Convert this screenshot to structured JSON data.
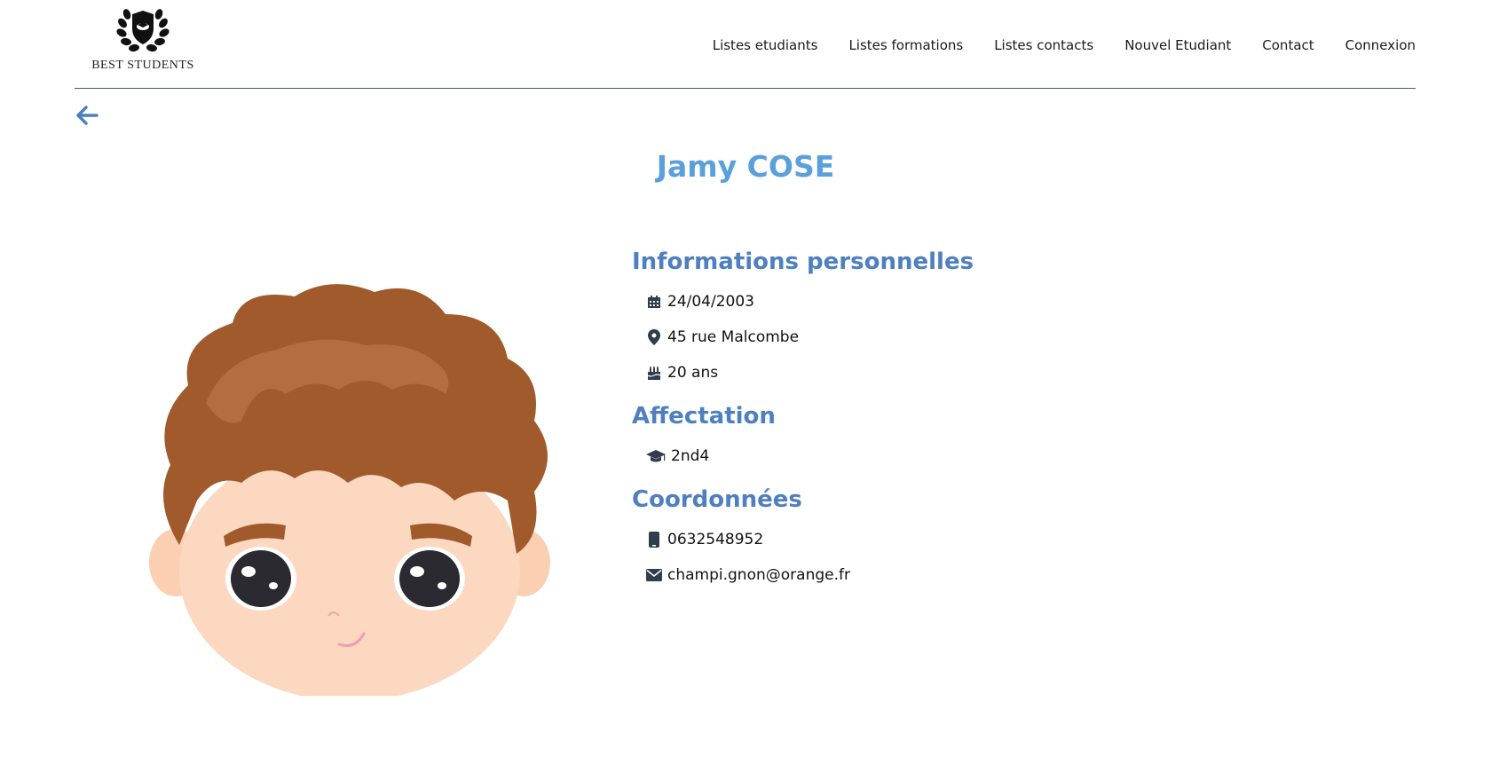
{
  "header": {
    "logo_text": "BEST STUDENTS",
    "nav": [
      {
        "label": "Listes etudiants"
      },
      {
        "label": "Listes formations"
      },
      {
        "label": "Listes contacts"
      },
      {
        "label": "Nouvel Etudiant"
      },
      {
        "label": "Contact"
      },
      {
        "label": "Connexion"
      }
    ]
  },
  "back": {
    "icon": "arrow-left-icon"
  },
  "student": {
    "name": "Jamy COSE",
    "avatar": "boy-avatar-illustration"
  },
  "sections": {
    "personal": {
      "title": "Informations personnelles",
      "birthdate": "24/04/2003",
      "address": "45 rue Malcombe",
      "age": "20 ans"
    },
    "assignment": {
      "title": "Affectation",
      "class": "2nd4"
    },
    "contact": {
      "title": "Coordonnées",
      "phone": "0632548952",
      "email": "champi.gnon@orange.fr"
    }
  },
  "colors": {
    "title": "#5aa0dd",
    "section": "#4e7fbf",
    "icon": "#2f3d4c",
    "hair": "#a05a2c",
    "skin": "#fdd8c0"
  }
}
